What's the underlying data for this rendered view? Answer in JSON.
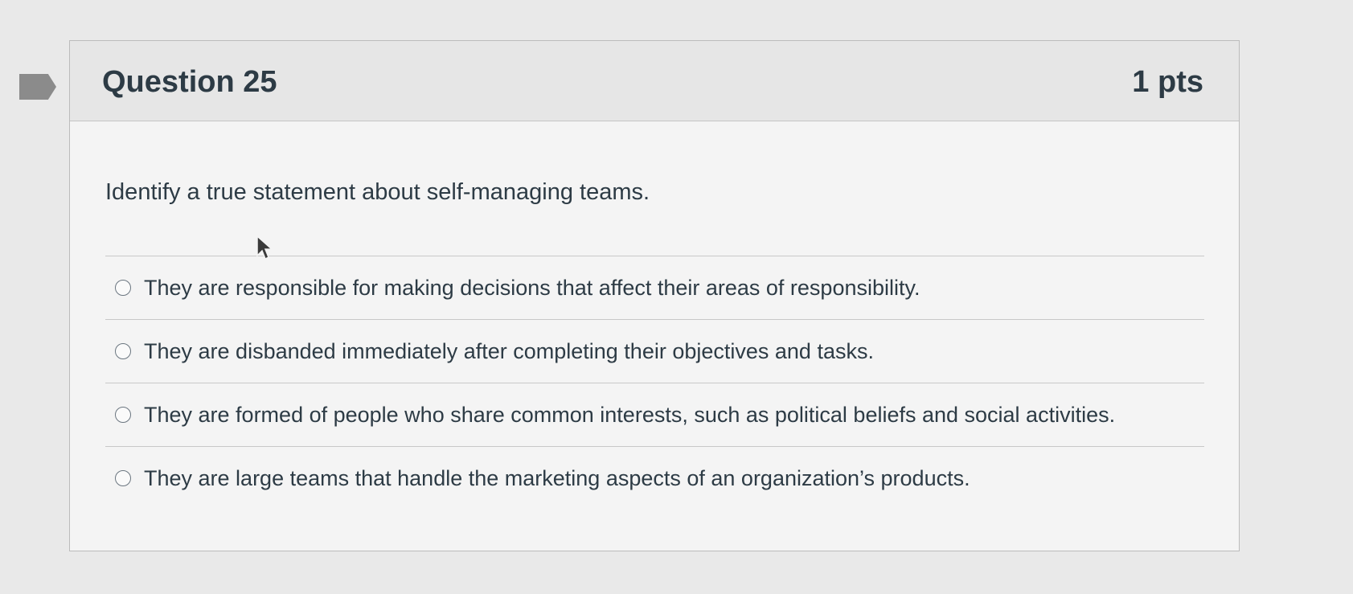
{
  "question": {
    "title": "Question 25",
    "points": "1 pts",
    "prompt": "Identify a true statement about self-managing teams.",
    "flag_icon": "bookmark-flag-icon",
    "answers": [
      {
        "label": "They are responsible for making decisions that affect their areas of responsibility.",
        "selected": false
      },
      {
        "label": "They are disbanded immediately after completing their objectives and tasks.",
        "selected": false
      },
      {
        "label": "They are formed of people who share common interests, such as political beliefs and social activities.",
        "selected": false
      },
      {
        "label": "They are large teams that handle the marketing aspects of an organization’s products.",
        "selected": false
      }
    ]
  },
  "colors": {
    "text": "#2d3b45",
    "header_bg": "#e6e6e6",
    "page_bg": "#e9e9e9",
    "flag": "#8b8b8b"
  }
}
